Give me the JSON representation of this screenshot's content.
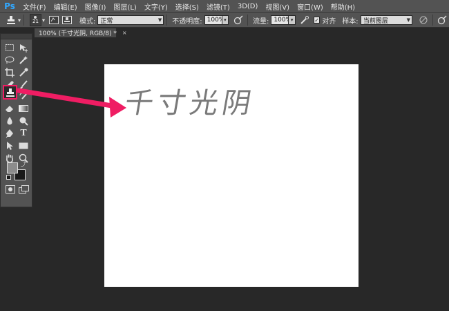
{
  "app": {
    "logo": "Ps"
  },
  "menu": {
    "items": [
      "文件(F)",
      "编辑(E)",
      "图像(I)",
      "图层(L)",
      "文字(Y)",
      "选择(S)",
      "滤镜(T)",
      "3D(D)",
      "视图(V)",
      "窗口(W)",
      "帮助(H)"
    ]
  },
  "options": {
    "brush_size": "21",
    "mode_label": "模式:",
    "mode_value": "正常",
    "opacity_label": "不透明度:",
    "opacity_value": "100%",
    "flow_label": "流量:",
    "flow_value": "100%",
    "align_label": "对齐",
    "align_checked": true,
    "sample_label": "样本:",
    "sample_value": "当前图层"
  },
  "document": {
    "tab_title": "100% (千寸光阴, RGB/8) *",
    "close_glyph": "×"
  },
  "canvas": {
    "text": "千寸光阴",
    "text_color": "#7a7a7a",
    "background": "#ffffff"
  },
  "toolbox": {
    "tools": [
      "marquee-tool",
      "move-tool",
      "lasso-tool",
      "magic-wand-tool",
      "crop-tool",
      "eyedropper-tool",
      "healing-brush-tool",
      "brush-tool",
      "clone-stamp-tool",
      "history-brush-tool",
      "eraser-tool",
      "gradient-tool",
      "blur-tool",
      "dodge-tool",
      "pen-tool",
      "type-tool",
      "path-selection-tool",
      "rectangle-tool",
      "hand-tool",
      "zoom-tool"
    ],
    "selected_tool": "clone-stamp-tool",
    "foreground_color": "#8c8c8c",
    "background_color": "#1a1a1a",
    "type_glyph": "T"
  },
  "annotation": {
    "color": "#ef1d63"
  },
  "colors": {
    "ui_panel": "#535353",
    "workspace": "#282828",
    "ps_blue": "#31a8ff"
  }
}
